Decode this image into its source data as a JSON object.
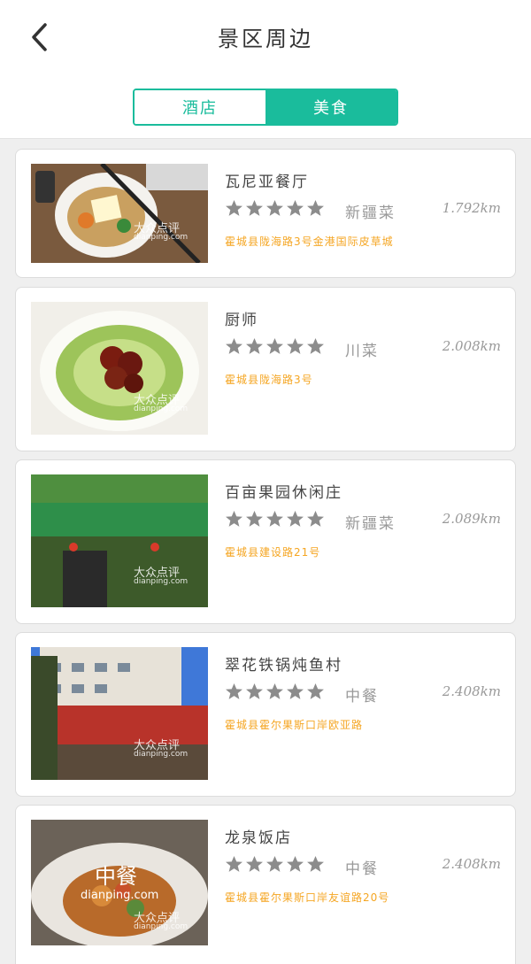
{
  "header": {
    "title": "景区周边",
    "tabs": [
      {
        "label": "酒店",
        "active": false
      },
      {
        "label": "美食",
        "active": true
      }
    ]
  },
  "accent_color": "#1abc9c",
  "address_color": "#f5a623",
  "restaurants": [
    {
      "name": "瓦尼亚餐厅",
      "rating": 5,
      "cuisine": "新疆菜",
      "distance": "1.792km",
      "address": "霍城县陇海路3号金港国际皮草城"
    },
    {
      "name": "厨师",
      "rating": 5,
      "cuisine": "川菜",
      "distance": "2.008km",
      "address": "霍城县陇海路3号"
    },
    {
      "name": "百亩果园休闲庄",
      "rating": 5,
      "cuisine": "新疆菜",
      "distance": "2.089km",
      "address": "霍城县建设路21号"
    },
    {
      "name": "翠花铁锅炖鱼村",
      "rating": 5,
      "cuisine": "中餐",
      "distance": "2.408km",
      "address": "霍城县霍尔果斯口岸欧亚路"
    },
    {
      "name": "龙泉饭店",
      "rating": 5,
      "cuisine": "中餐",
      "distance": "2.408km",
      "address": "霍城县霍尔果斯口岸友谊路20号"
    }
  ],
  "photo_watermark": "大众点评",
  "photo_watermark_sub": "dianping.com",
  "placeholder_photo_label": "中餐",
  "placeholder_photo_sub": "dianping.com"
}
